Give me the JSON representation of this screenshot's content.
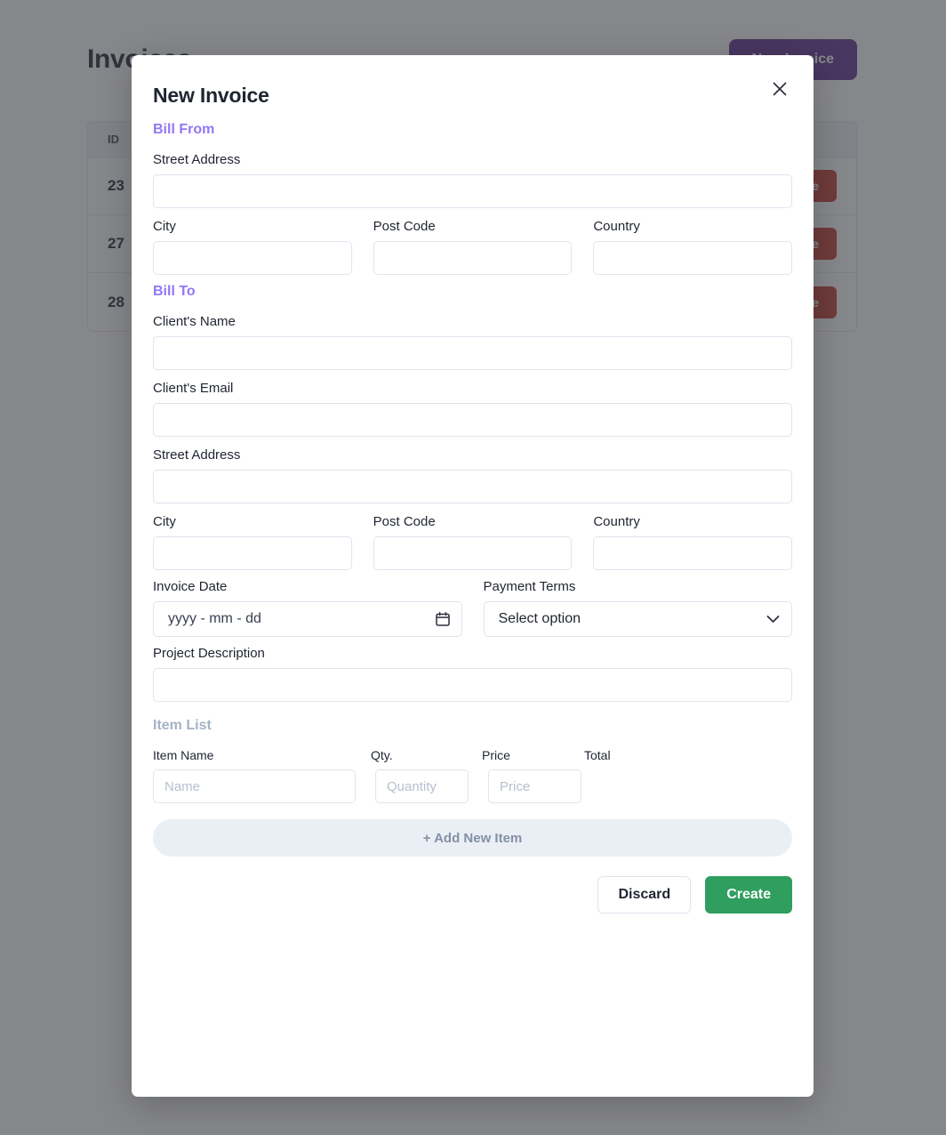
{
  "background": {
    "page_title": "Invoices",
    "new_invoice_button": "New Invoice",
    "table": {
      "columns": [
        "ID",
        "",
        "",
        ""
      ],
      "rows": [
        {
          "id": "23",
          "action": "Delete"
        },
        {
          "id": "27",
          "action": "Delete"
        },
        {
          "id": "28",
          "action": "Delete"
        }
      ]
    },
    "colors": {
      "accent_purple": "#5c2d91",
      "danger_red": "#c0392b"
    }
  },
  "modal": {
    "title": "New Invoice",
    "close_icon": "close-icon",
    "bill_from": {
      "section_label": "Bill From",
      "street_address_label": "Street Address",
      "street_address_value": "",
      "city_label": "City",
      "city_value": "",
      "post_code_label": "Post Code",
      "post_code_value": "",
      "country_label": "Country",
      "country_value": ""
    },
    "bill_to": {
      "section_label": "Bill To",
      "client_name_label": "Client's Name",
      "client_name_value": "",
      "client_email_label": "Client's Email",
      "client_email_value": "",
      "street_address_label": "Street Address",
      "street_address_value": "",
      "city_label": "City",
      "city_value": "",
      "post_code_label": "Post Code",
      "post_code_value": "",
      "country_label": "Country",
      "country_value": "",
      "invoice_date_label": "Invoice Date",
      "invoice_date_placeholder": "yyyy - mm - dd",
      "calendar_icon": "calendar-icon",
      "payment_terms_label": "Payment Terms",
      "payment_terms_value": "Select option",
      "payment_terms_chevron": "chevron-down-icon",
      "project_description_label": "Project Description",
      "project_description_value": ""
    },
    "item_list": {
      "section_label": "Item List",
      "columns": {
        "item_name": "Item Name",
        "qty": "Qty.",
        "price": "Price",
        "total": "Total"
      },
      "rows": [
        {
          "name_placeholder": "Name",
          "name_value": "",
          "qty_placeholder": "Quantity",
          "qty_value": "",
          "price_placeholder": "Price",
          "price_value": "",
          "total_value": ""
        }
      ],
      "add_item_button": "+ Add New Item"
    },
    "footer": {
      "discard_button": "Discard",
      "create_button": "Create"
    },
    "colors": {
      "section_purple": "#9277f5",
      "section_muted": "#a5b2c6",
      "create_green": "#2f9e5f",
      "input_border": "#dfe4ee"
    }
  }
}
